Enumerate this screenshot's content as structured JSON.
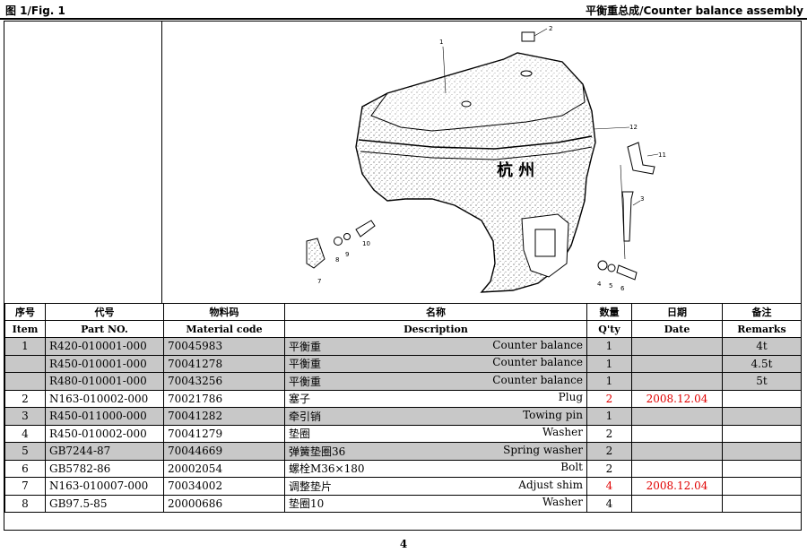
{
  "header": {
    "fig_label": "图 1/Fig. 1",
    "assembly_title": "平衡重总成/Counter balance assembly"
  },
  "drawing": {
    "callouts": [
      "1",
      "2",
      "3",
      "4",
      "5",
      "6",
      "7",
      "8",
      "9",
      "10",
      "11",
      "12"
    ],
    "chars": "杭 州"
  },
  "table": {
    "headers_cn": [
      "序号",
      "代号",
      "物料码",
      "名称",
      "数量",
      "日期",
      "备注"
    ],
    "headers_en": [
      "Item",
      "Part NO.",
      "Material code",
      "Description",
      "Q'ty",
      "Date",
      "Remarks"
    ],
    "rows": [
      {
        "item": "1",
        "part": "R420-010001-000",
        "code": "70045983",
        "cn": "平衡重",
        "en": "Counter balance",
        "qty": "1",
        "date": "",
        "remarks": "4t"
      },
      {
        "item": "",
        "part": "R450-010001-000",
        "code": "70041278",
        "cn": "平衡重",
        "en": "Counter balance",
        "qty": "1",
        "date": "",
        "remarks": "4.5t"
      },
      {
        "item": "",
        "part": "R480-010001-000",
        "code": "70043256",
        "cn": "平衡重",
        "en": "Counter balance",
        "qty": "1",
        "date": "",
        "remarks": "5t"
      },
      {
        "item": "2",
        "part": "N163-010002-000",
        "code": "70021786",
        "cn": "塞子",
        "en": "Plug",
        "qty": "2",
        "date": "2008.12.04",
        "remarks": ""
      },
      {
        "item": "3",
        "part": "R450-011000-000",
        "code": "70041282",
        "cn": "牵引销",
        "en": "Towing pin",
        "qty": "1",
        "date": "",
        "remarks": ""
      },
      {
        "item": "4",
        "part": "R450-010002-000",
        "code": "70041279",
        "cn": "垫圈",
        "en": "Washer",
        "qty": "2",
        "date": "",
        "remarks": ""
      },
      {
        "item": "5",
        "part": "GB7244-87",
        "code": "70044669",
        "cn": "弹簧垫圈36",
        "en": "Spring washer",
        "qty": "2",
        "date": "",
        "remarks": ""
      },
      {
        "item": "6",
        "part": "GB5782-86",
        "code": "20002054",
        "cn": "螺栓M36×180",
        "en": "Bolt",
        "qty": "2",
        "date": "",
        "remarks": ""
      },
      {
        "item": "7",
        "part": "N163-010007-000",
        "code": "70034002",
        "cn": "调整垫片",
        "en": "Adjust shim",
        "qty": "4",
        "date": "2008.12.04",
        "remarks": ""
      },
      {
        "item": "8",
        "part": "GB97.5-85",
        "code": "20000686",
        "cn": "垫圈10",
        "en": "Washer",
        "qty": "4",
        "date": "",
        "remarks": ""
      }
    ]
  },
  "page_number": "4"
}
